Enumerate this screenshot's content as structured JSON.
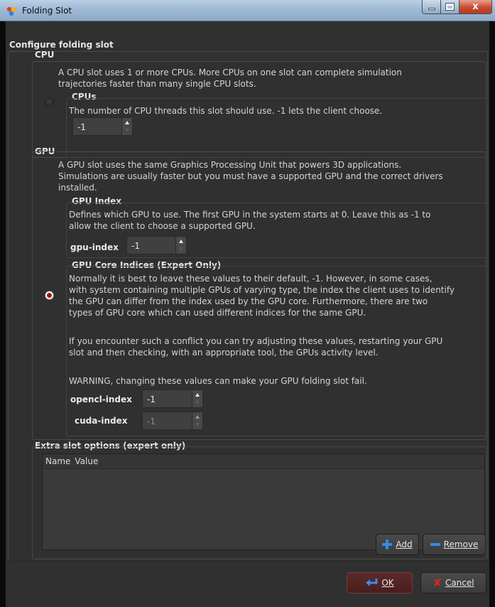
{
  "window": {
    "title": "Folding Slot",
    "minimize_icon": "minimize-icon",
    "maximize_icon": "maximize-icon",
    "close_icon": "close-icon",
    "close_glyph": "x"
  },
  "configure": {
    "title": "Configure folding slot"
  },
  "cpu": {
    "title": "CPU",
    "desc_lines": [
      "A CPU slot uses 1 or more CPUs.  More CPUs on one slot can complete simulation",
      "trajectories faster than many single CPU slots."
    ],
    "selected": false,
    "cpus": {
      "title": "CPUs",
      "desc": "The number of CPU threads this slot should use.  -1 lets the client choose.",
      "value": "-1"
    }
  },
  "gpu": {
    "title": "GPU",
    "selected": true,
    "desc_lines": [
      "A GPU slot uses the same Graphics Processing Unit that powers 3D applications.",
      "Simulations are usually faster but you must have a supported GPU and the correct drivers",
      "installed."
    ],
    "index": {
      "title": "GPU Index",
      "desc_lines": [
        "Defines which GPU to use.  The first GPU in the system starts at 0.  Leave this as -1 to",
        "allow the client to choose a supported GPU."
      ],
      "label": "gpu-index",
      "value": "-1"
    },
    "core": {
      "title": "GPU Core Indices (Expert Only)",
      "desc_lines": [
        "Normally it is best to leave these values to their default, -1.  However, in some cases,",
        "with system containing multiple GPUs of varying type, the index the client uses to identify",
        "the GPU can differ from the index used by the GPU core.  Furthermore, there are two",
        "types of GPU core which can used different indices for the same GPU.",
        "",
        "If you encounter such a conflict you can try adjusting these values, restarting your GPU",
        "slot and then checking, with an appropriate tool, the GPUs activity level.",
        "",
        "WARNING, changing these values can make your GPU folding slot fail."
      ],
      "opencl_label": "opencl-index",
      "opencl_value": "-1",
      "cuda_label": "cuda-index",
      "cuda_value": "-1"
    }
  },
  "extra": {
    "title": "Extra slot options (expert only)",
    "columns": [
      "Name",
      "Value"
    ],
    "rows": [],
    "add_label": "Add",
    "remove_label": "Remove"
  },
  "footer": {
    "ok_label": "OK",
    "cancel_label": "Cancel"
  },
  "colors": {
    "background": "#303030",
    "accent_blue": "#2f8de4",
    "radio_selected": "#a01414",
    "cancel_red": "#e52020"
  }
}
